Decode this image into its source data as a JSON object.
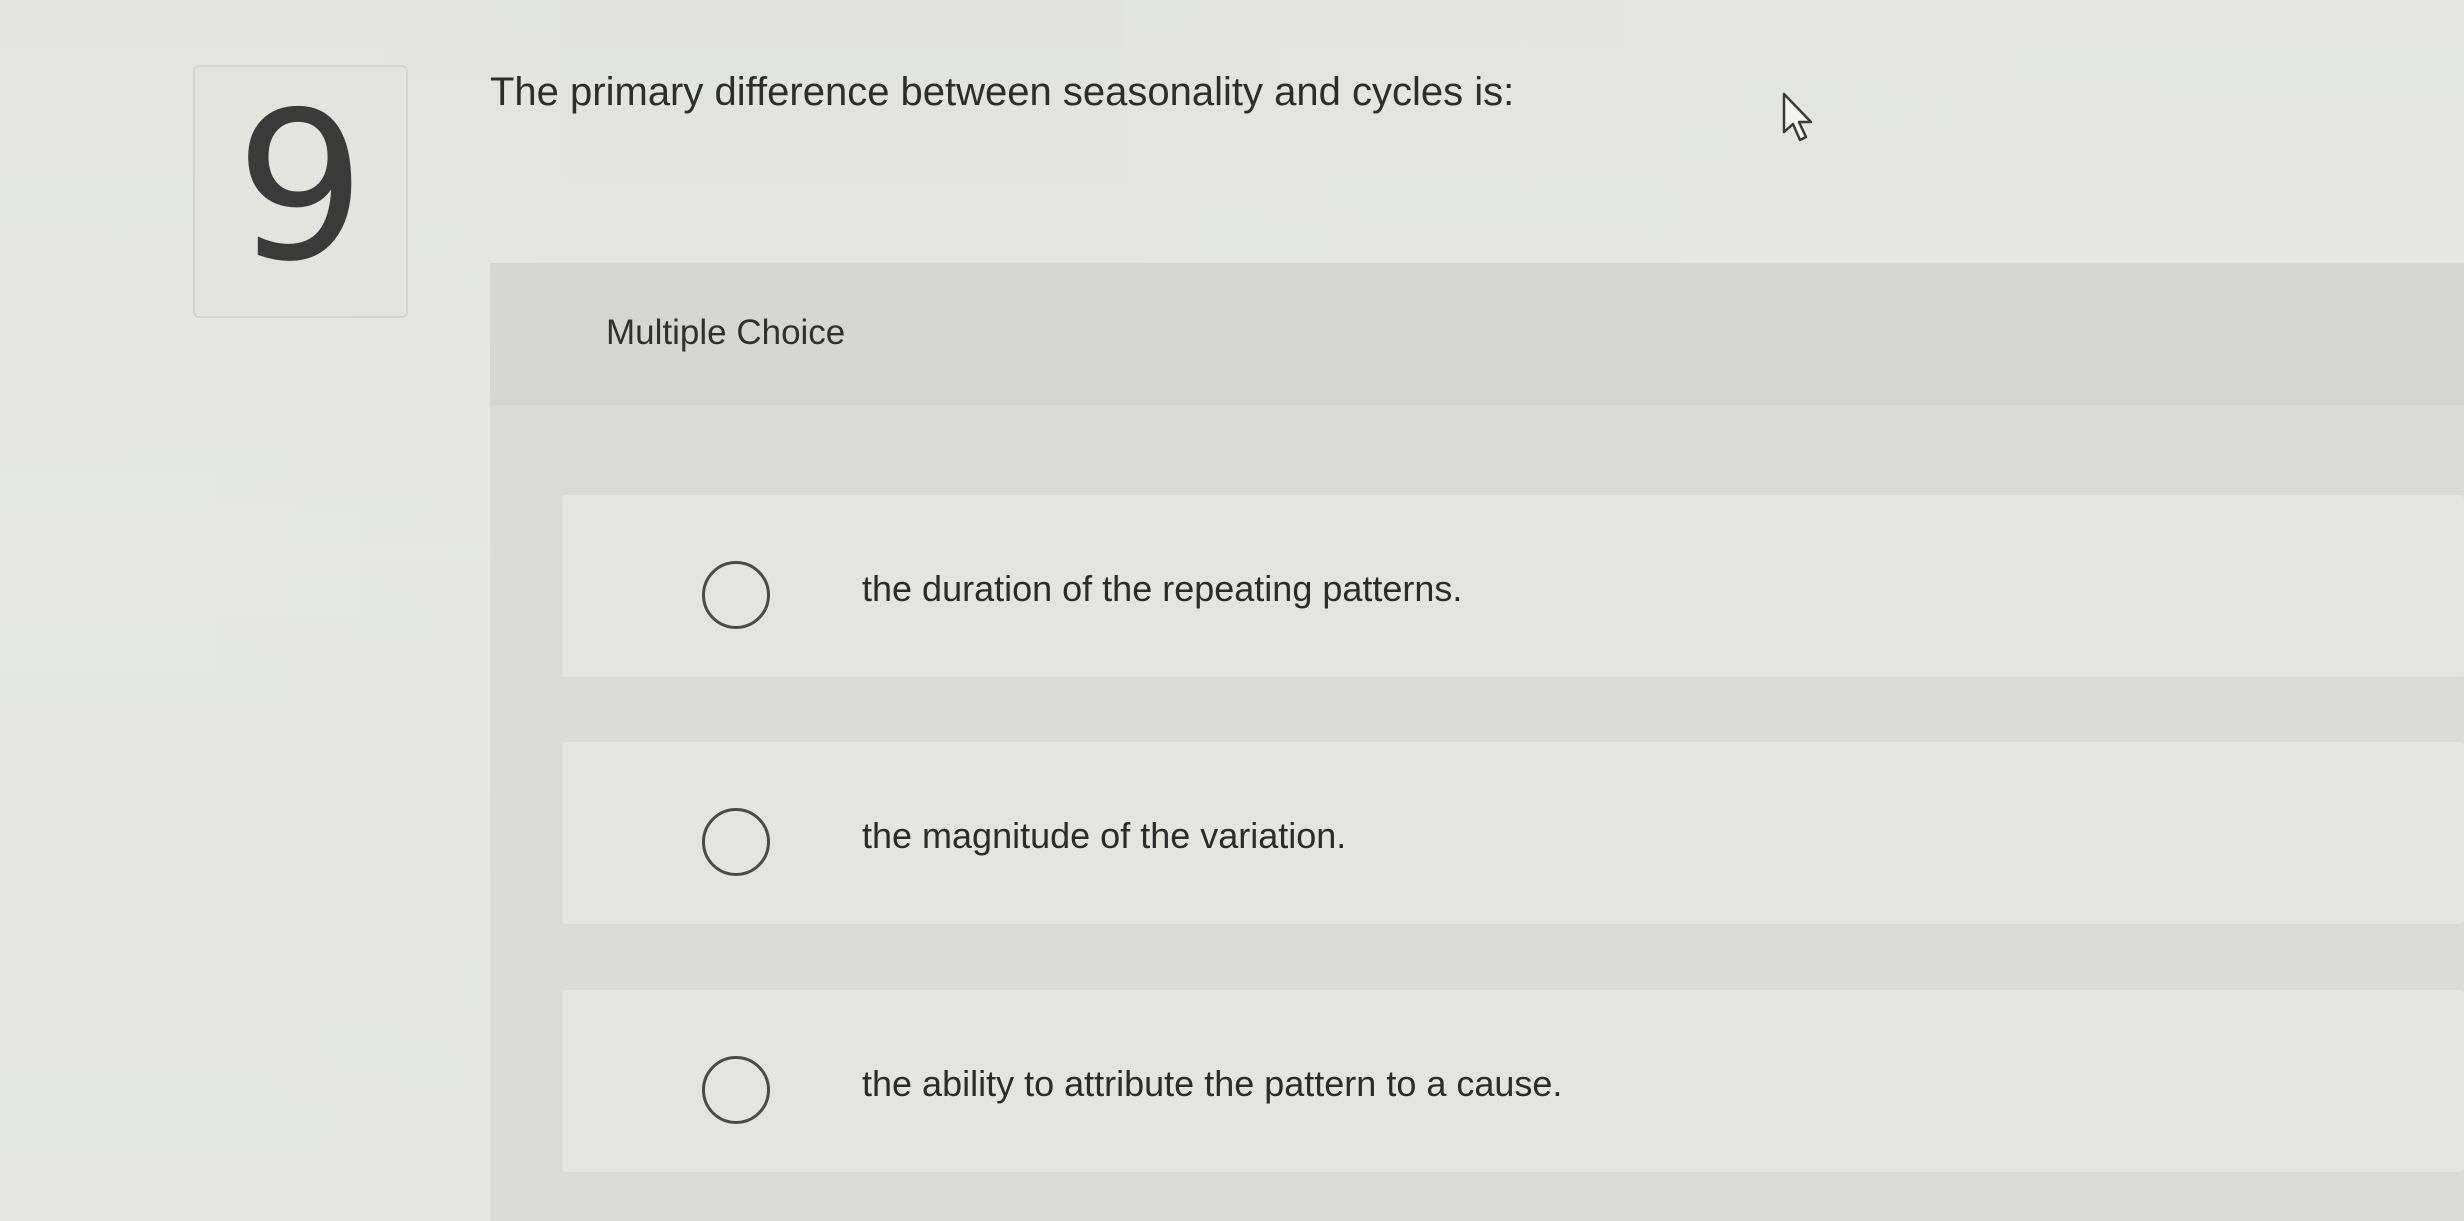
{
  "question": {
    "number": "9",
    "text": "The primary difference between seasonality and cycles is:"
  },
  "answer_panel": {
    "type_label": "Multiple Choice",
    "choices": [
      {
        "label": "the duration of the repeating patterns.",
        "selected": false
      },
      {
        "label": "the magnitude of the variation.",
        "selected": false
      },
      {
        "label": "the ability to attribute the pattern to a cause.",
        "selected": false
      }
    ]
  },
  "icons": {
    "pointer": "cursor-arrow-icon",
    "radio": "radio-unchecked-icon"
  }
}
